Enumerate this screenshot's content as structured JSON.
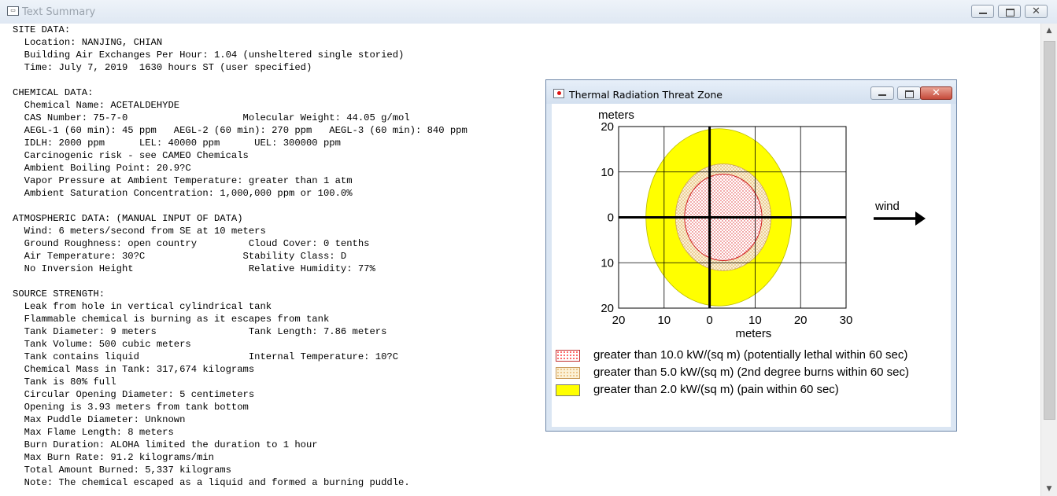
{
  "main_window": {
    "title": "Text Summary",
    "icon": "document-icon",
    "controls": [
      "minimize-icon",
      "maximize-icon",
      "close-icon"
    ],
    "lines": [
      "SITE DATA:",
      "  Location: NANJING, CHIAN",
      "  Building Air Exchanges Per Hour: 1.04 (unsheltered single storied)",
      "  Time: July 7, 2019  1630 hours ST (user specified)",
      "",
      "CHEMICAL DATA:",
      "  Chemical Name: ACETALDEHYDE",
      "  CAS Number: 75-7-0                    Molecular Weight: 44.05 g/mol",
      "  AEGL-1 (60 min): 45 ppm   AEGL-2 (60 min): 270 ppm   AEGL-3 (60 min): 840 ppm",
      "  IDLH: 2000 ppm      LEL: 40000 ppm      UEL: 300000 ppm",
      "  Carcinogenic risk - see CAMEO Chemicals",
      "  Ambient Boiling Point: 20.9?C",
      "  Vapor Pressure at Ambient Temperature: greater than 1 atm",
      "  Ambient Saturation Concentration: 1,000,000 ppm or 100.0%",
      "",
      "ATMOSPHERIC DATA: (MANUAL INPUT OF DATA)",
      "  Wind: 6 meters/second from SE at 10 meters",
      "  Ground Roughness: open country         Cloud Cover: 0 tenths",
      "  Air Temperature: 30?C                 Stability Class: D",
      "  No Inversion Height                    Relative Humidity: 77%",
      "",
      "SOURCE STRENGTH:",
      "  Leak from hole in vertical cylindrical tank",
      "  Flammable chemical is burning as it escapes from tank",
      "  Tank Diameter: 9 meters                Tank Length: 7.86 meters",
      "  Tank Volume: 500 cubic meters",
      "  Tank contains liquid                   Internal Temperature: 10?C",
      "  Chemical Mass in Tank: 317,674 kilograms",
      "  Tank is 80% full",
      "  Circular Opening Diameter: 5 centimeters",
      "  Opening is 3.93 meters from tank bottom",
      "  Max Puddle Diameter: Unknown",
      "  Max Flame Length: 8 meters",
      "  Burn Duration: ALOHA limited the duration to 1 hour",
      "  Max Burn Rate: 91.2 kilograms/min",
      "  Total Amount Burned: 5,337 kilograms",
      "  Note: The chemical escaped as a liquid and formed a burning puddle."
    ]
  },
  "threat_window": {
    "title": "Thermal Radiation Threat Zone",
    "icon": "threat-zone-icon",
    "controls": [
      "minimize-icon",
      "maximize-icon",
      "close-icon"
    ],
    "wind_label": "wind",
    "legend": [
      {
        "label": "greater than 10.0 kW/(sq m) (potentially lethal within 60 sec)",
        "color": "#ff3b3b",
        "pattern": "dots"
      },
      {
        "label": "greater than 5.0 kW/(sq m) (2nd degree burns within 60 sec)",
        "color": "#e8b872",
        "pattern": "dots"
      },
      {
        "label": "greater than 2.0 kW/(sq m) (pain within 60 sec)",
        "color": "#ffff00",
        "pattern": "solid"
      }
    ]
  },
  "chart_data": {
    "type": "area",
    "xlabel": "meters",
    "ylabel": "meters",
    "x_ticks": [
      "20",
      "10",
      "0",
      "10",
      "20",
      "30"
    ],
    "y_ticks": [
      "20",
      "10",
      "0",
      "10",
      "20"
    ],
    "x_range": [
      -20,
      30
    ],
    "y_range": [
      -20,
      20
    ],
    "grid": true,
    "zones": [
      {
        "name": "greater than 2.0 kW/(sq m)",
        "color": "#ffff00",
        "center": [
          2,
          0
        ],
        "radius": 16
      },
      {
        "name": "greater than 5.0 kW/(sq m)",
        "color": "#f6e2b8",
        "center": [
          3,
          0
        ],
        "radius": 10.5
      },
      {
        "name": "greater than 10.0 kW/(sq m)",
        "color": "#ffe9e9",
        "center": [
          3,
          0
        ],
        "radius": 8.5
      }
    ],
    "wind_direction": "east"
  }
}
